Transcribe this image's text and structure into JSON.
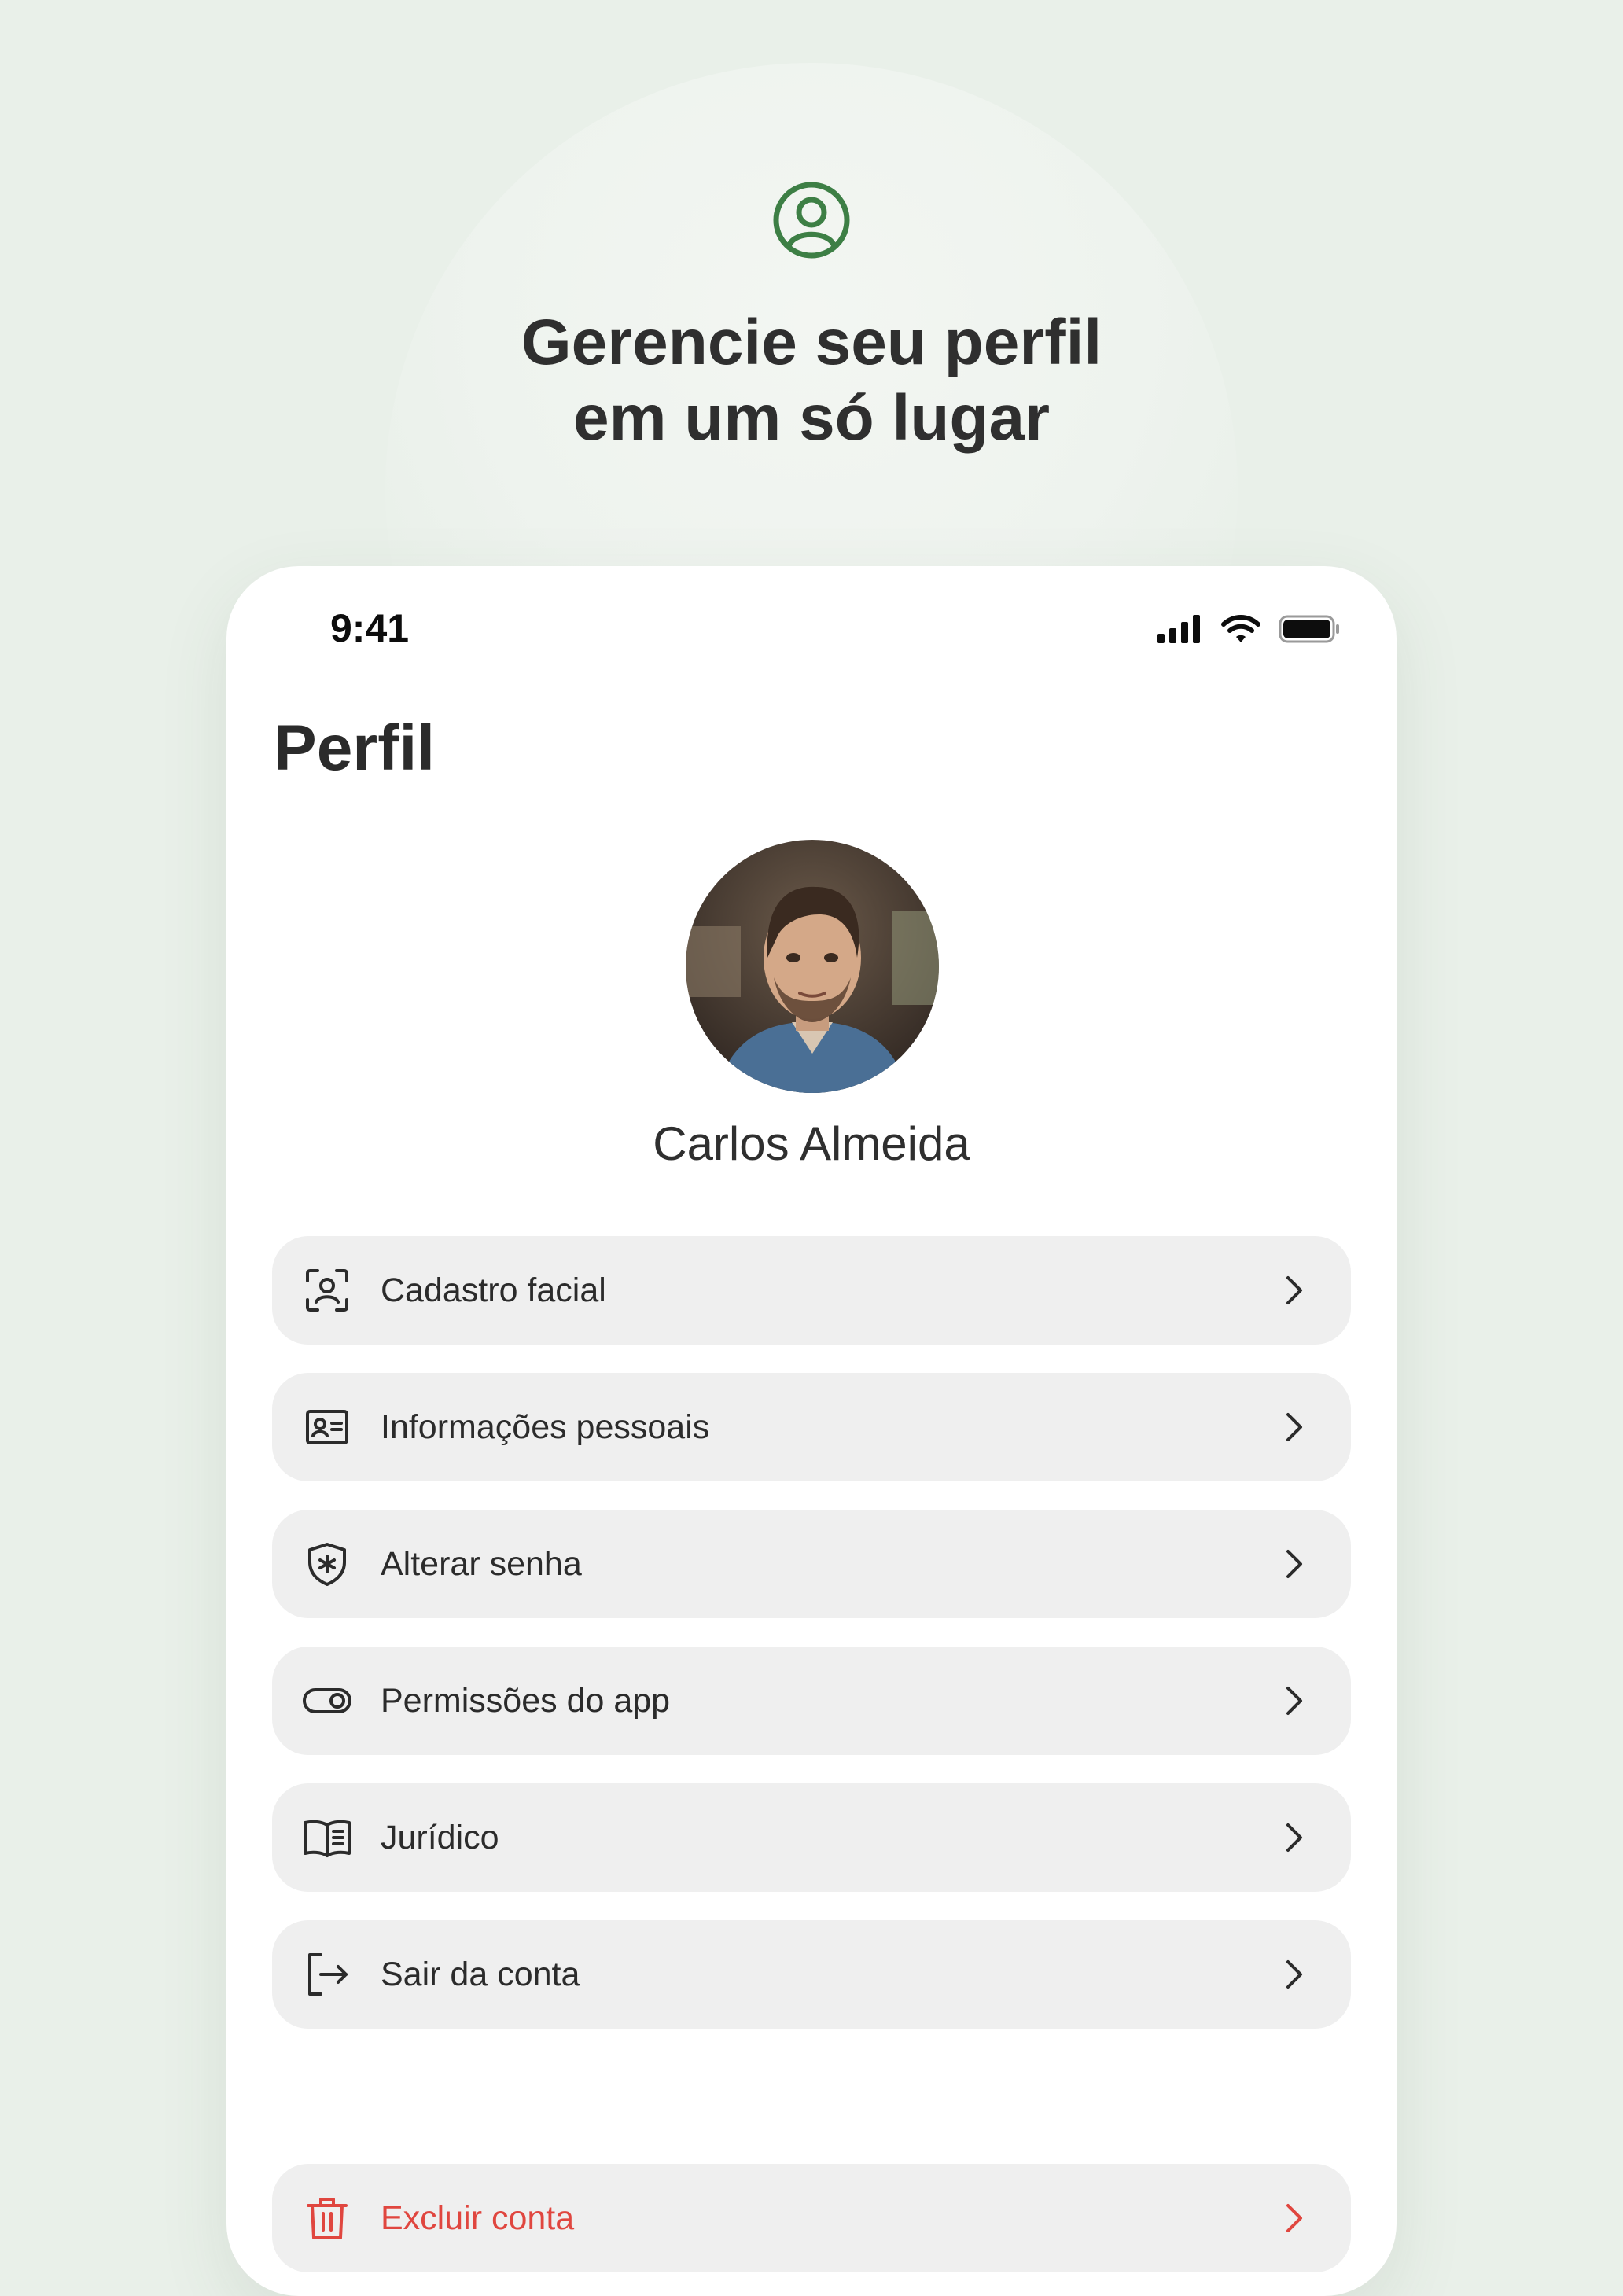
{
  "hero": {
    "icon": "user-circle-icon",
    "title_line1": "Gerencie seu perfil",
    "title_line2": "em um só lugar",
    "accent_color": "#3d7f45"
  },
  "status_bar": {
    "time": "9:41",
    "icons": [
      "cellular-signal-icon",
      "wifi-icon",
      "battery-icon"
    ]
  },
  "page": {
    "title": "Perfil"
  },
  "profile": {
    "name": "Carlos Almeida"
  },
  "menu": {
    "items": [
      {
        "label": "Cadastro facial",
        "icon": "face-scan-icon"
      },
      {
        "label": "Informações pessoais",
        "icon": "id-card-icon"
      },
      {
        "label": "Alterar senha",
        "icon": "shield-asterisk-icon"
      },
      {
        "label": "Permissões do app",
        "icon": "toggle-icon"
      },
      {
        "label": "Jurídico",
        "icon": "book-icon"
      },
      {
        "label": "Sair da conta",
        "icon": "logout-icon"
      }
    ],
    "danger_item": {
      "label": "Excluir conta",
      "icon": "trash-icon",
      "color": "#e0463f"
    }
  }
}
